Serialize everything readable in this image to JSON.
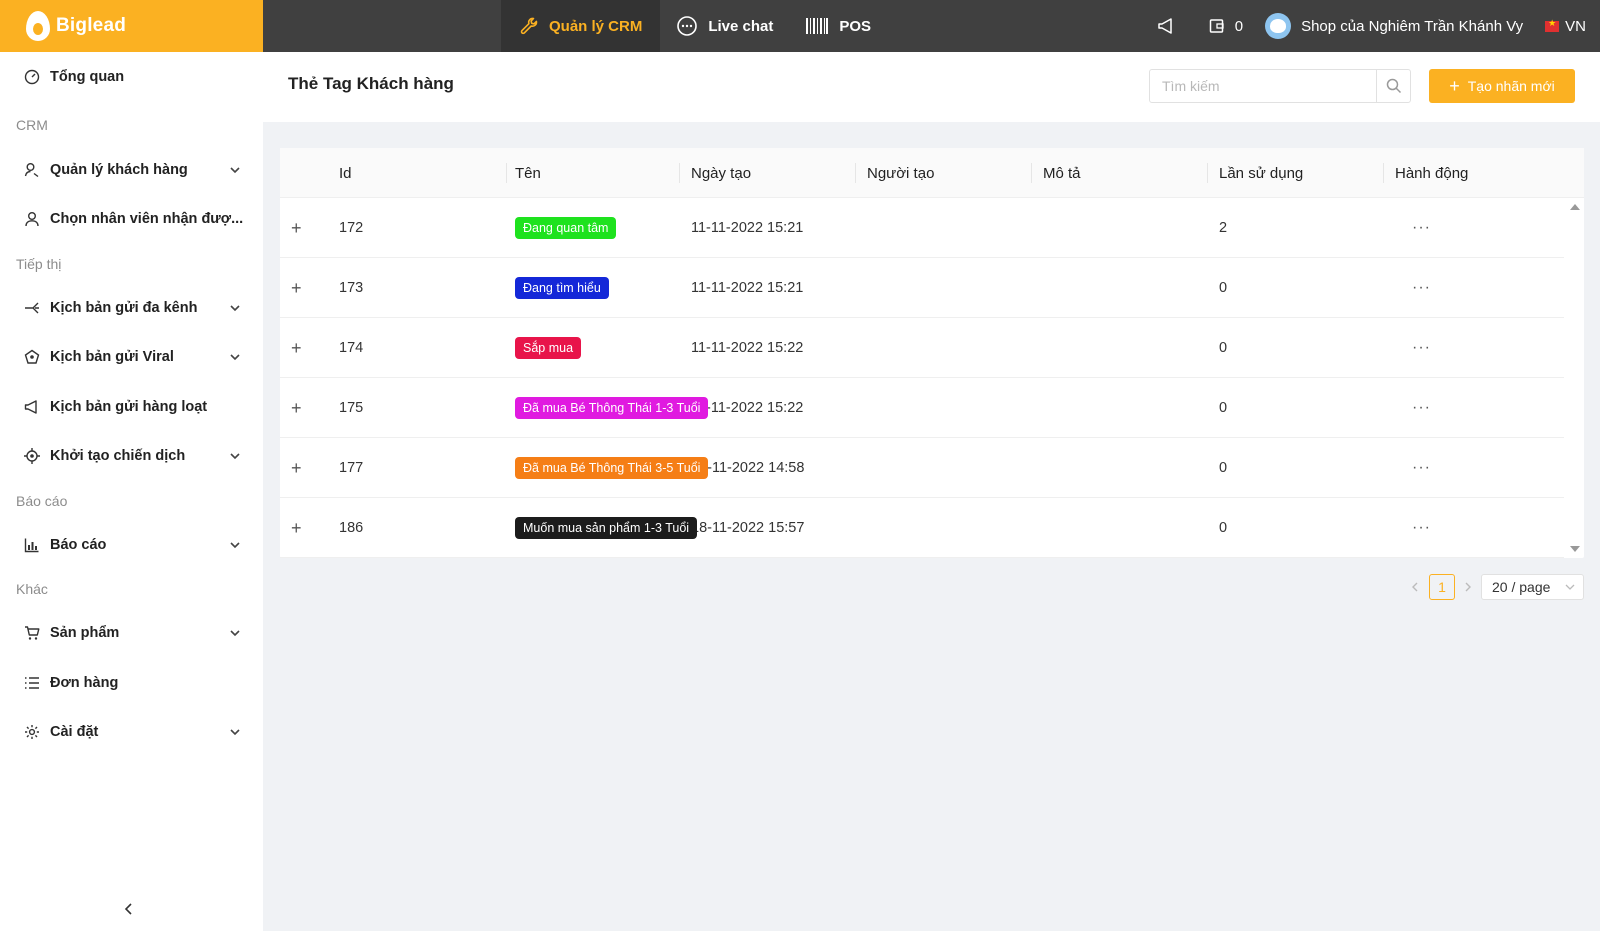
{
  "brand": {
    "name": "Biglead",
    "accent": "#fbb122"
  },
  "topnav": [
    {
      "label": "Quản lý CRM",
      "icon": "wrench-icon",
      "active": true
    },
    {
      "label": "Live chat",
      "icon": "chat-bubble-icon",
      "active": false
    },
    {
      "label": "POS",
      "icon": "barcode-icon",
      "active": false
    }
  ],
  "topright": {
    "notification_count": "0",
    "shop_name": "Shop của Nghiêm Trần Khánh Vy",
    "language": "VN"
  },
  "sidebar": {
    "overview": "Tổng quan",
    "section_crm": "CRM",
    "customer_mgmt": "Quản lý khách hàng",
    "choose_staff": "Chọn nhân viên nhận đượ...",
    "section_marketing": "Tiếp thị",
    "multichannel": "Kịch bản gửi đa kênh",
    "viral": "Kịch bản gửi Viral",
    "bulk": "Kịch bản gửi hàng loạt",
    "campaign": "Khởi tạo chiến dịch",
    "section_reports": "Báo cáo",
    "reports": "Báo cáo",
    "section_other": "Khác",
    "products": "Sản phẩm",
    "orders": "Đơn hàng",
    "settings": "Cài đặt"
  },
  "page": {
    "title": "Thẻ Tag Khách hàng",
    "search_placeholder": "Tìm kiếm",
    "create_label": "Tạo nhãn mới"
  },
  "table": {
    "columns": [
      "Id",
      "Tên",
      "Ngày tạo",
      "Người tạo",
      "Mô tả",
      "Lần sử dụng",
      "Hành động"
    ],
    "rows": [
      {
        "id": "172",
        "tag": "Đang quan tâm",
        "color": "#1ee21e",
        "created": "11-11-2022 15:21",
        "creator": "",
        "desc": "",
        "uses": "2",
        "action": "···"
      },
      {
        "id": "173",
        "tag": "Đang tìm hiểu",
        "color": "#1428d8",
        "created": "11-11-2022 15:21",
        "creator": "",
        "desc": "",
        "uses": "0",
        "action": "···"
      },
      {
        "id": "174",
        "tag": "Sắp mua",
        "color": "#e8144a",
        "created": "11-11-2022 15:22",
        "creator": "",
        "desc": "",
        "uses": "0",
        "action": "···"
      },
      {
        "id": "175",
        "tag": "Đã mua Bé Thông Thái 1-3 Tuổi",
        "color": "#e01ae0",
        "created": "11-11-2022 15:22",
        "creator": "",
        "desc": "",
        "uses": "0",
        "action": "···"
      },
      {
        "id": "177",
        "tag": "Đã mua Bé Thông Thái 3-5 Tuổi",
        "color": "#f57e16",
        "created": "12-11-2022 14:58",
        "creator": "",
        "desc": "",
        "uses": "0",
        "action": "···"
      },
      {
        "id": "186",
        "tag": "Muốn mua sản phẩm 1-3 Tuổi",
        "color": "#1c1c1c",
        "created": "18-11-2022 15:57",
        "creator": "",
        "desc": "",
        "uses": "0",
        "action": "···"
      }
    ]
  },
  "pagination": {
    "current": "1",
    "page_size": "20 / page"
  }
}
